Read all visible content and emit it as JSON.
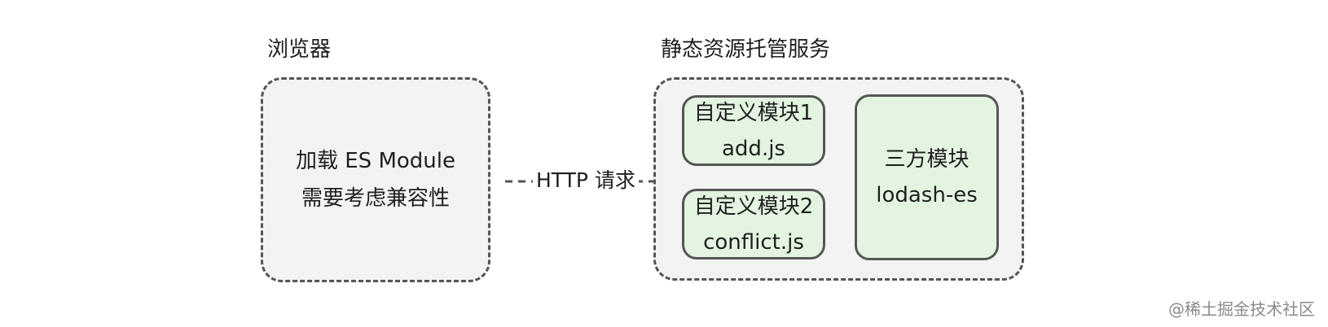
{
  "browser": {
    "title": "浏览器",
    "line1": "加载 ES Module",
    "line2": "需要考虑兼容性"
  },
  "connection": {
    "label": "HTTP 请求"
  },
  "server": {
    "title": "静态资源托管服务",
    "custom_modules": [
      {
        "title": "自定义模块1",
        "file": "add.js"
      },
      {
        "title": "自定义模块2",
        "file": "conflict.js"
      }
    ],
    "third_party": {
      "title": "三方模块",
      "name": "lodash-es"
    }
  },
  "watermark": "@稀土掘金技术社区",
  "colors": {
    "container_fill": "#f3f3f3",
    "module_fill": "#e3f4e1",
    "border": "#555555"
  }
}
